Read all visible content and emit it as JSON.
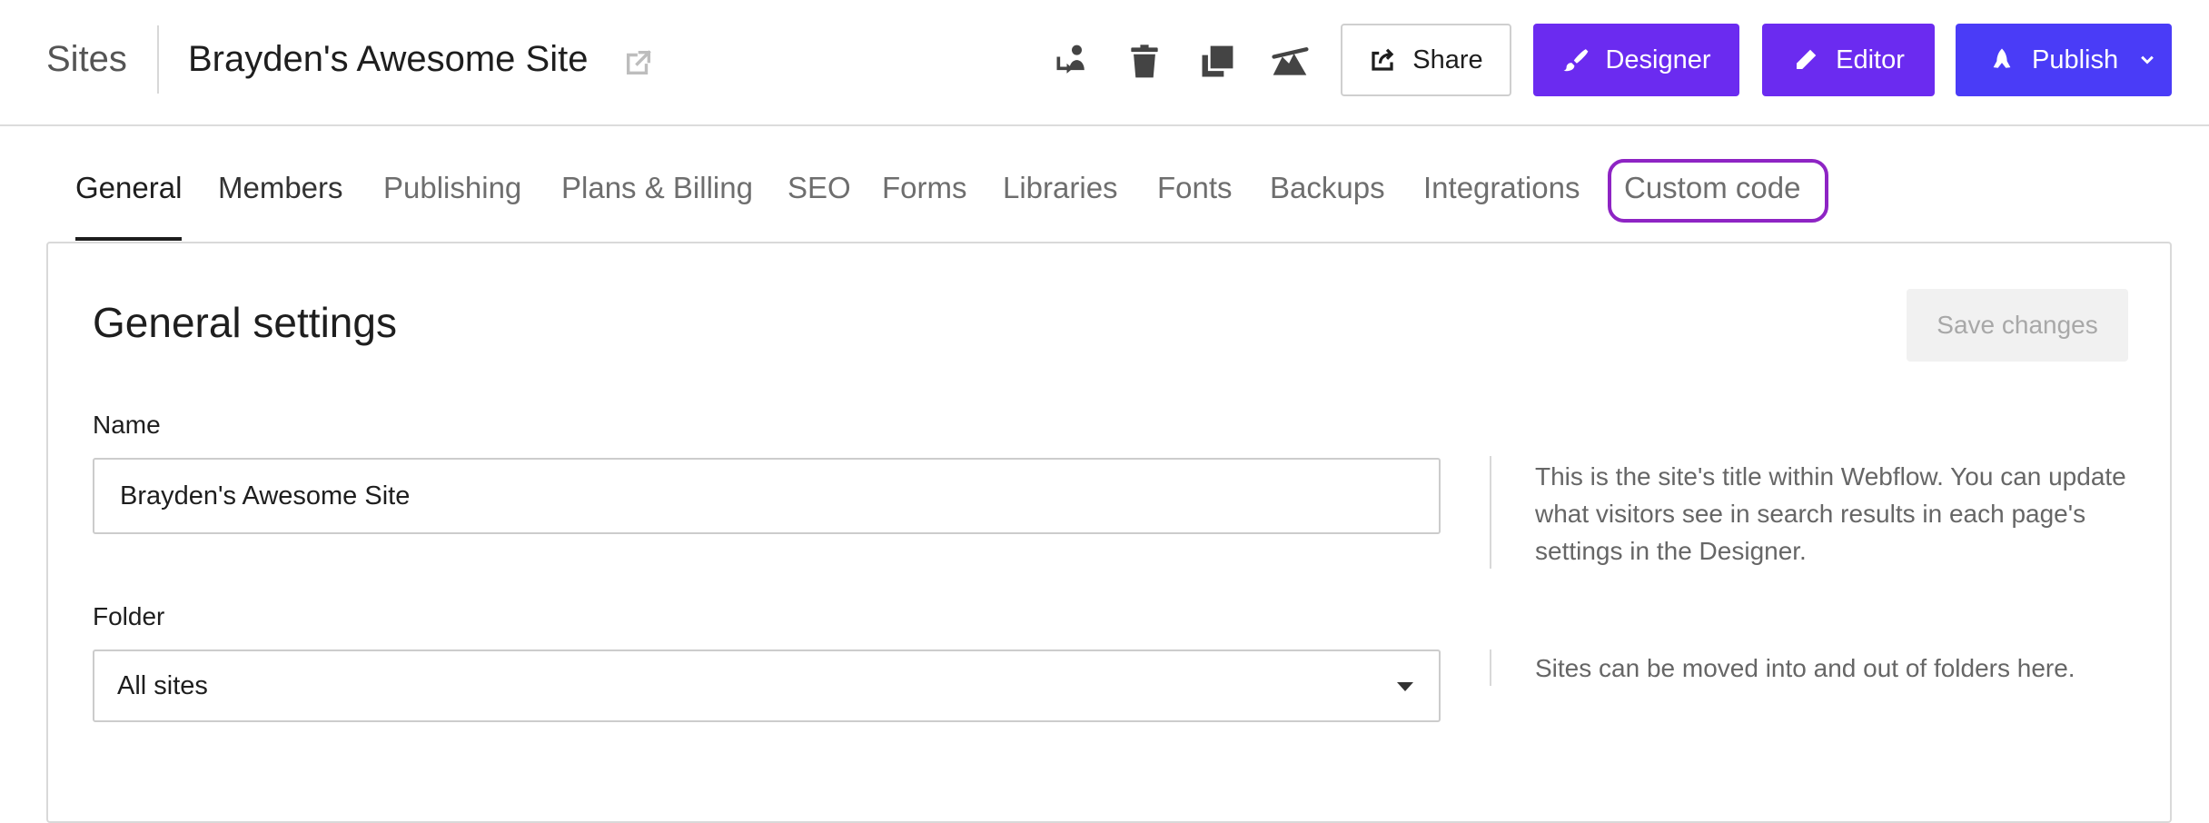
{
  "header": {
    "breadcrumb_root": "Sites",
    "site_title": "Brayden's Awesome Site",
    "icons": [
      "external-link-icon",
      "transfer-site-icon",
      "trash-icon",
      "duplicate-icon",
      "unpublish-icon"
    ],
    "share_label": "Share",
    "designer_label": "Designer",
    "editor_label": "Editor",
    "publish_label": "Publish"
  },
  "tabs": [
    {
      "label": "General",
      "active": true
    },
    {
      "label": "Members"
    },
    {
      "label": "Publishing"
    },
    {
      "label": "Plans & Billing"
    },
    {
      "label": "SEO"
    },
    {
      "label": "Forms"
    },
    {
      "label": "Libraries"
    },
    {
      "label": "Fonts"
    },
    {
      "label": "Backups"
    },
    {
      "label": "Integrations"
    },
    {
      "label": "Custom code",
      "highlighted": true
    }
  ],
  "general": {
    "title": "General settings",
    "save_label": "Save changes",
    "name_label": "Name",
    "name_value": "Brayden's Awesome Site",
    "name_help": "This is the site's title within Webflow. You can update what visitors see in search results in each page's settings in the Designer.",
    "folder_label": "Folder",
    "folder_value": "All sites",
    "folder_help": "Sites can be moved into and out of folders here."
  },
  "colors": {
    "designer": "#6b2bf0",
    "editor": "#6b2bf0",
    "publish": "#4a3cf7",
    "highlight": "#8e24c4"
  }
}
